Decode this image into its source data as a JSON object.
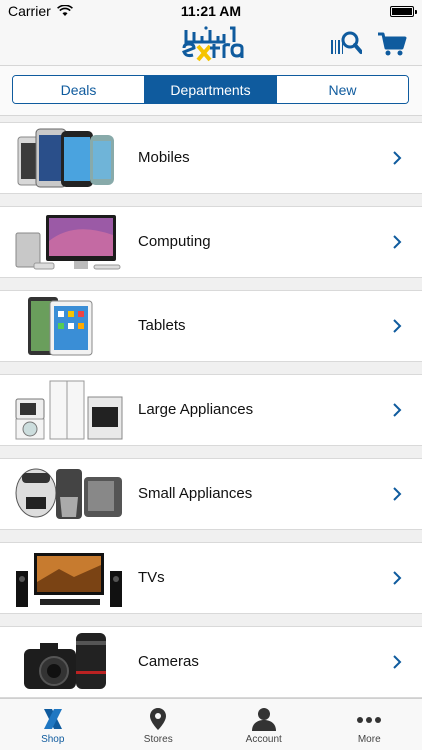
{
  "status_bar": {
    "carrier": "Carrier",
    "time": "11:21 AM"
  },
  "header": {
    "logo_text": "اكسترا extra"
  },
  "segments": [
    {
      "label": "Deals",
      "active": false
    },
    {
      "label": "Departments",
      "active": true
    },
    {
      "label": "New",
      "active": false
    }
  ],
  "departments": [
    {
      "label": "Mobiles"
    },
    {
      "label": "Computing"
    },
    {
      "label": "Tablets"
    },
    {
      "label": "Large Appliances"
    },
    {
      "label": "Small Appliances"
    },
    {
      "label": "TVs"
    },
    {
      "label": "Cameras"
    }
  ],
  "tabs": [
    {
      "label": "Shop",
      "icon": "shop-x-icon",
      "active": true
    },
    {
      "label": "Stores",
      "icon": "location-pin-icon",
      "active": false
    },
    {
      "label": "Account",
      "icon": "person-icon",
      "active": false
    },
    {
      "label": "More",
      "icon": "more-dots-icon",
      "active": false
    }
  ],
  "colors": {
    "brand_blue": "#0f5b9e",
    "logo_yellow": "#f5c400"
  }
}
